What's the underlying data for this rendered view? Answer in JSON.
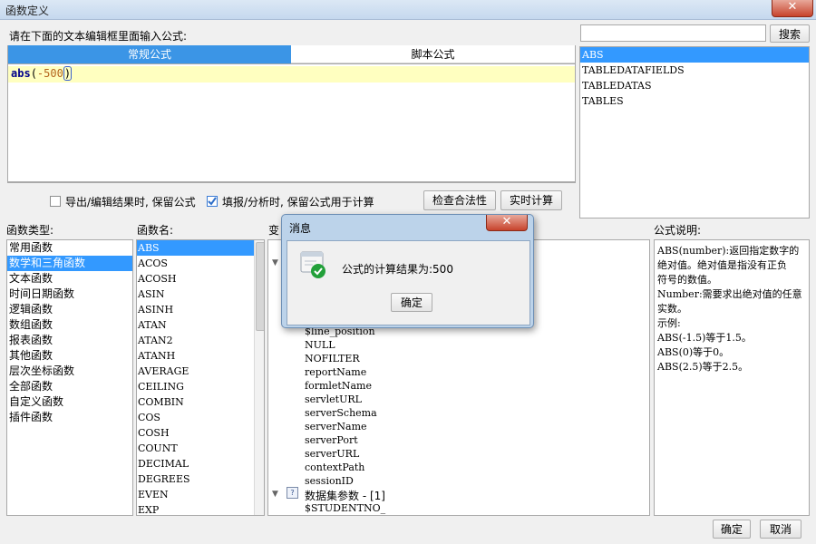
{
  "window": {
    "title": "函数定义",
    "close_glyph": "✕"
  },
  "search": {
    "value": "",
    "button_label": "搜索"
  },
  "editor": {
    "prompt": "请在下面的文本编辑框里面输入公式:",
    "tabs": [
      {
        "label": "常规公式",
        "active": true
      },
      {
        "label": "脚本公式",
        "active": false
      }
    ],
    "code_fn": "abs",
    "code_open": "(",
    "code_num": "-500",
    "code_close": ")"
  },
  "top_right_list": [
    "ABS",
    "TABLEDATAFIELDS",
    "TABLEDATAS",
    "TABLES"
  ],
  "options": {
    "export_keep": {
      "label": "导出/编辑结果时, 保留公式",
      "checked": false
    },
    "fill_keep": {
      "label": "填报/分析时, 保留公式用于计算",
      "checked": true
    },
    "check_button": "检查合法性",
    "calc_button": "实时计算"
  },
  "function_types": {
    "header": "函数类型:",
    "items": [
      "常用函数",
      "数学和三角函数",
      "文本函数",
      "时间日期函数",
      "逻辑函数",
      "数组函数",
      "报表函数",
      "其他函数",
      "层次坐标函数",
      "全部函数",
      "自定义函数",
      "插件函数"
    ],
    "selected": "数学和三角函数"
  },
  "function_names": {
    "header": "函数名:",
    "items": [
      "ABS",
      "ACOS",
      "ACOSH",
      "ASIN",
      "ASINH",
      "ATAN",
      "ATAN2",
      "ATANH",
      "AVERAGE",
      "CEILING",
      "COMBIN",
      "COS",
      "COSH",
      "COUNT",
      "DECIMAL",
      "DEGREES",
      "EVEN",
      "EXP"
    ],
    "selected": "ABS"
  },
  "variables": {
    "header": "变",
    "items": [
      "$line_position",
      "NULL",
      "NOFILTER",
      "reportName",
      "formletName",
      "servletURL",
      "serverSchema",
      "serverName",
      "serverPort",
      "serverURL",
      "contextPath",
      "sessionID"
    ],
    "group_label": "数据集参数 - [1]",
    "group_child": "$STUDENTNO_"
  },
  "description": {
    "header": "公式说明:",
    "lines": [
      "ABS(number):返回指定数字的",
      "绝对值。绝对值是指没有正负",
      "符号的数值。",
      "Number:需要求出绝对值的任意",
      "实数。",
      "示例:",
      "ABS(-1.5)等于1.5。",
      "ABS(0)等于0。",
      "ABS(2.5)等于2.5。"
    ]
  },
  "footer": {
    "ok": "确定",
    "cancel": "取消"
  },
  "message_dialog": {
    "title": "消息",
    "text": "公式的计算结果为:500",
    "ok": "确定",
    "close_glyph": "✕",
    "status_color": "#22a03a"
  }
}
